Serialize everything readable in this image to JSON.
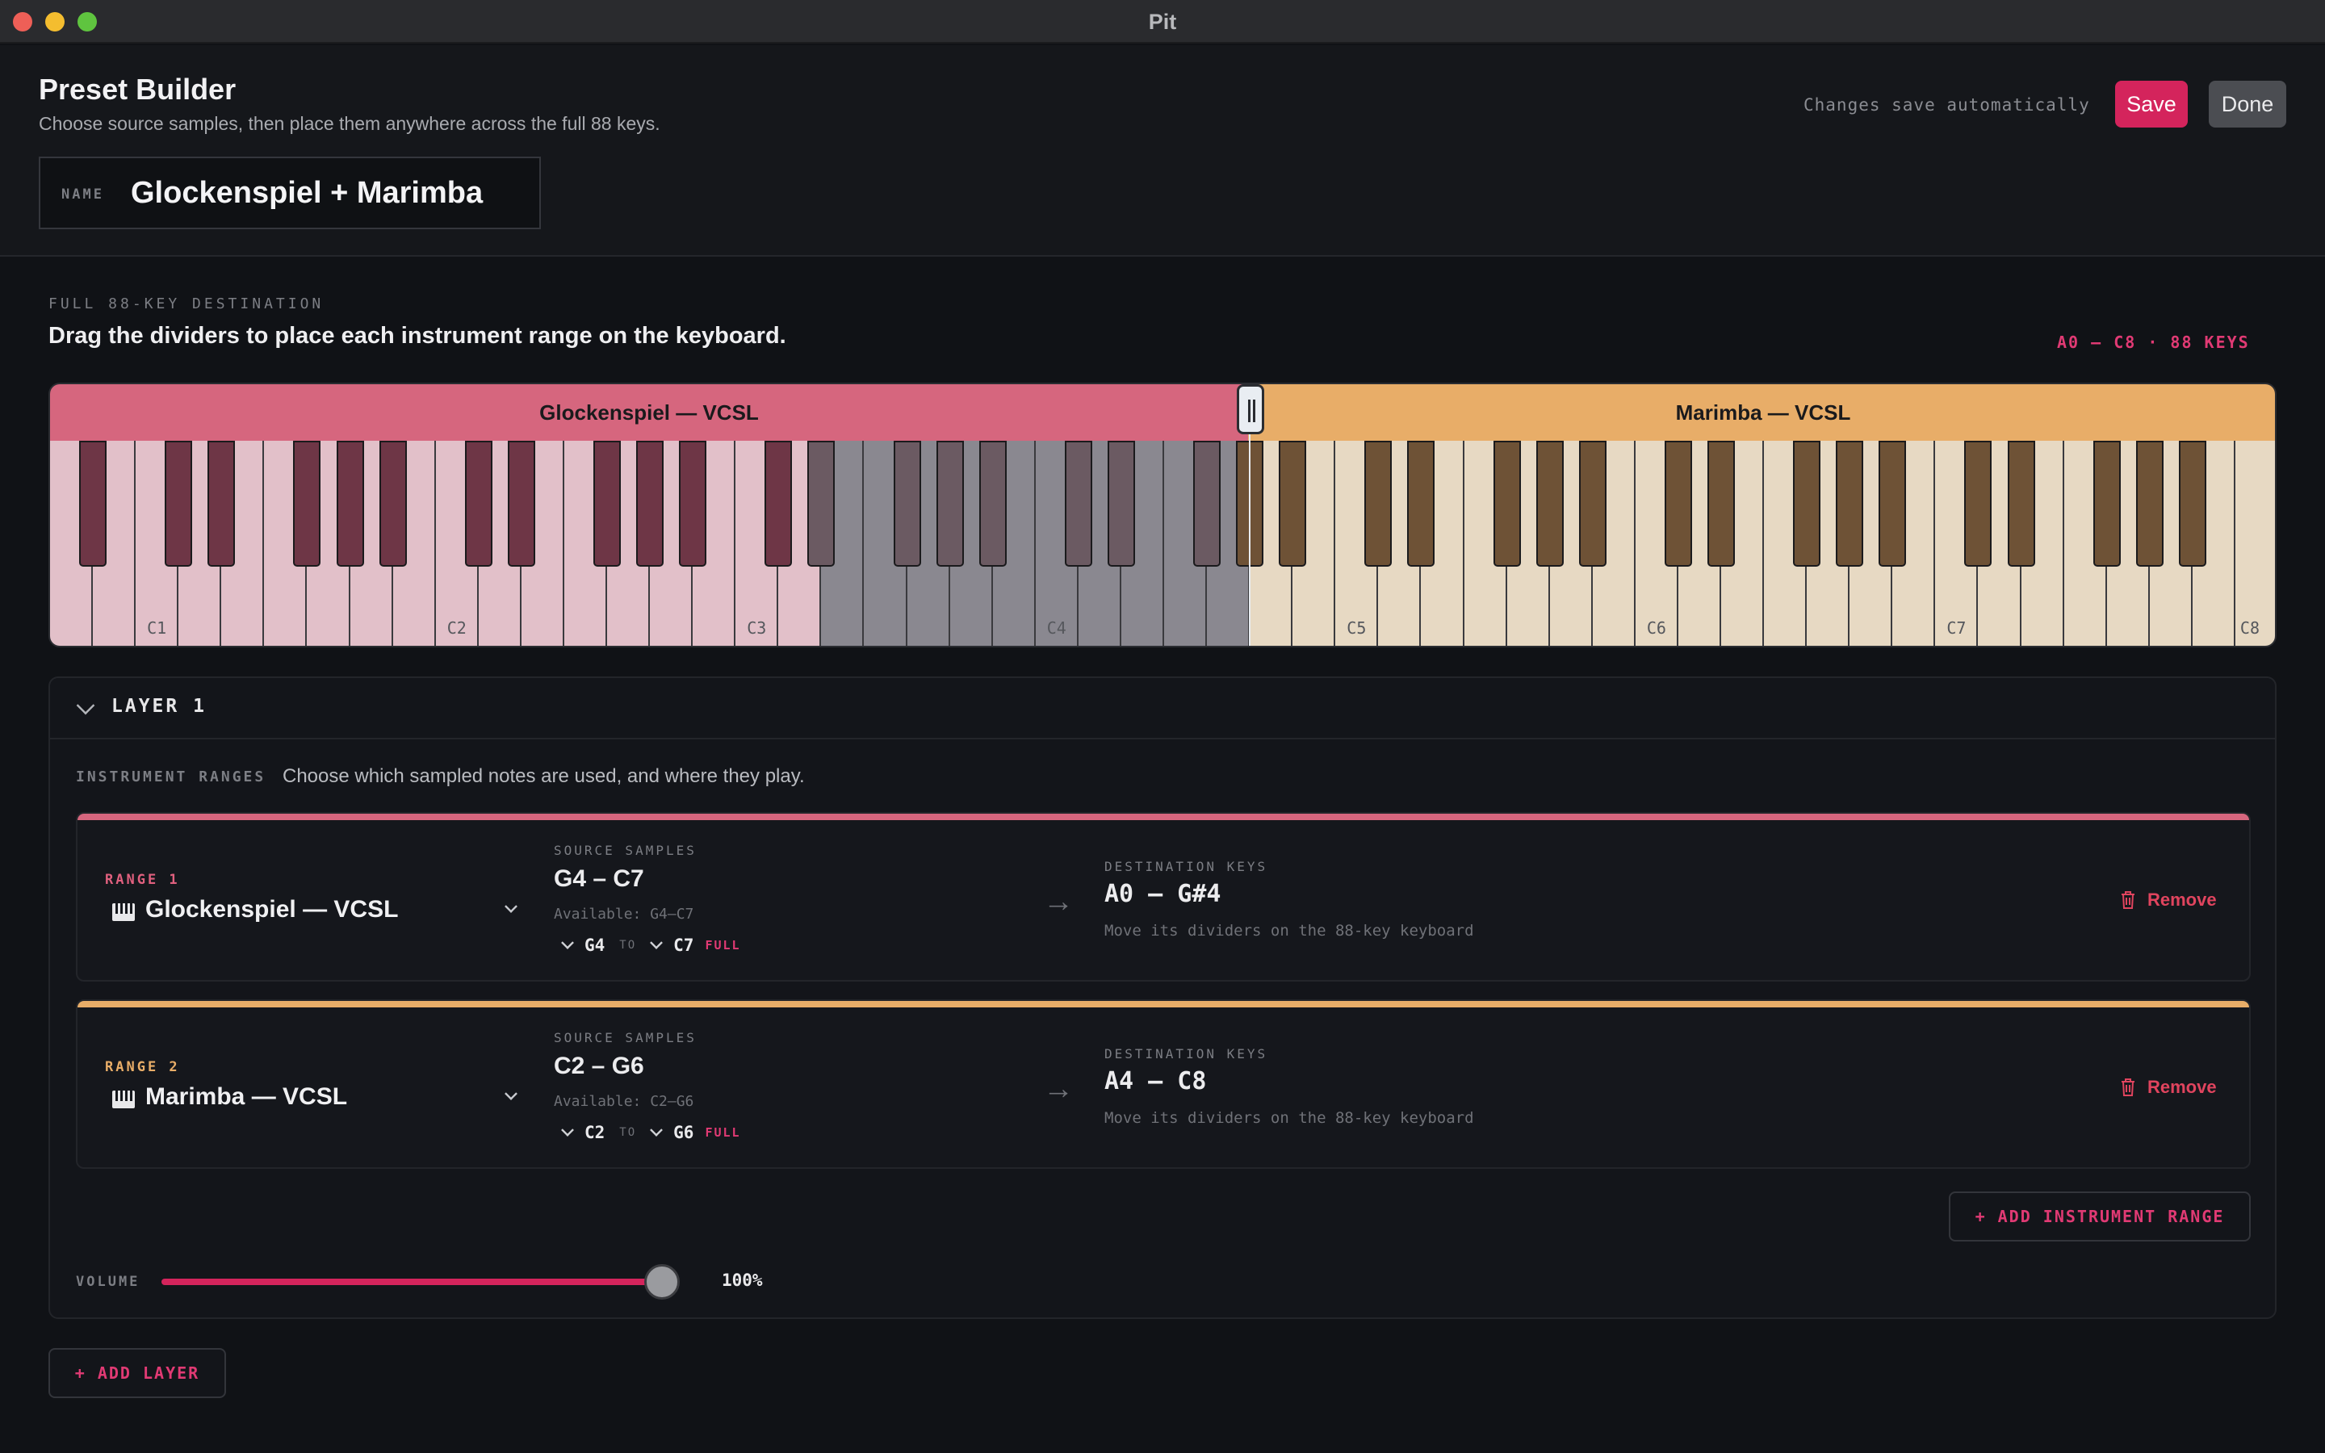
{
  "window": {
    "title": "Pit"
  },
  "header": {
    "title": "Preset Builder",
    "subtitle": "Choose source samples, then place them anywhere across the full 88 keys.",
    "name_label": "NAME",
    "name_value": "Glockenspiel + Marimba",
    "autosave_text": "Changes save automatically",
    "save_label": "Save",
    "done_label": "Done"
  },
  "keyboard_section": {
    "label": "FULL 88-KEY DESTINATION",
    "heading": "Drag the dividers to place each instrument range on the keyboard.",
    "readout": "A0 – C8  ·  88 KEYS",
    "bands": [
      {
        "name": "Glockenspiel — VCSL",
        "color": "#d6667e",
        "range": "A0 – G#4"
      },
      {
        "name": "Marimba — VCSL",
        "color": "#e8ad68",
        "range": "A4 – C8"
      }
    ],
    "octave_labels": [
      "C1",
      "C2",
      "C3",
      "C4",
      "C5",
      "C6",
      "C7",
      "C8"
    ],
    "source_highlight": "G4 – C7 shaded region in gray"
  },
  "layer": {
    "title": "LAYER 1",
    "instrument_ranges_label": "INSTRUMENT RANGES",
    "instrument_ranges_desc": "Choose which sampled notes are used, and where they play.",
    "ranges": [
      {
        "num_label": "RANGE 1",
        "instrument": "Glockenspiel — VCSL",
        "source_label": "SOURCE SAMPLES",
        "source_value": "G4 – C7",
        "available": "Available: G4–C7",
        "from_note": "G4",
        "to_text": "TO",
        "to_note": "C7",
        "full_badge": "FULL",
        "dest_label": "DESTINATION KEYS",
        "dest_value": "A0 – G#4",
        "dest_hint": "Move its dividers on the 88-key keyboard",
        "remove_label": "Remove"
      },
      {
        "num_label": "RANGE 2",
        "instrument": "Marimba — VCSL",
        "source_label": "SOURCE SAMPLES",
        "source_value": "C2 – G6",
        "available": "Available: C2–G6",
        "from_note": "C2",
        "to_text": "TO",
        "to_note": "G6",
        "full_badge": "FULL",
        "dest_label": "DESTINATION KEYS",
        "dest_value": "A4 – C8",
        "dest_hint": "Move its dividers on the 88-key keyboard",
        "remove_label": "Remove"
      }
    ],
    "add_range_label": "ADD INSTRUMENT RANGE",
    "volume_label": "VOLUME",
    "volume_value": "100%",
    "volume_level": 1.0
  },
  "add_layer_label": "ADD LAYER",
  "colors": {
    "accent": "#d4245c",
    "glock": "#d6667e",
    "marimba": "#e8ad68"
  },
  "icons": [
    "chevron-down-icon",
    "piano-icon",
    "arrow-right-icon",
    "trash-icon",
    "plus-icon"
  ]
}
